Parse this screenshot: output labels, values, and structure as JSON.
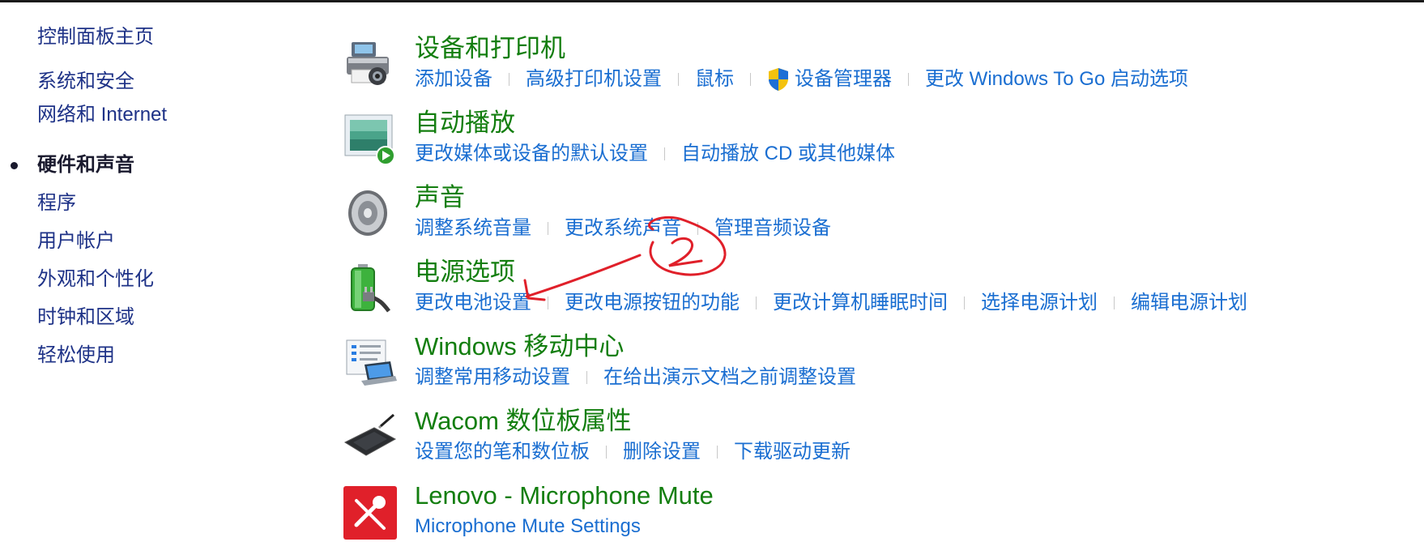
{
  "nav": {
    "items": [
      {
        "label": "控制面板主页",
        "active": false
      },
      {
        "label": "系统和安全",
        "active": false
      },
      {
        "label": "网络和 Internet",
        "active": false
      },
      {
        "label": "硬件和声音",
        "active": true
      },
      {
        "label": "程序",
        "active": false
      },
      {
        "label": "用户帐户",
        "active": false
      },
      {
        "label": "外观和个性化",
        "active": false
      },
      {
        "label": "时钟和区域",
        "active": false
      },
      {
        "label": "轻松使用",
        "active": false
      }
    ]
  },
  "categories": [
    {
      "title": "设备和打印机",
      "icon": "printer-icon",
      "links": [
        "添加设备",
        "高级打印机设置",
        "鼠标",
        "设备管理器",
        "更改 Windows To Go 启动选项"
      ]
    },
    {
      "title": "自动播放",
      "icon": "autoplay-icon",
      "links": [
        "更改媒体或设备的默认设置",
        "自动播放 CD 或其他媒体"
      ]
    },
    {
      "title": "声音",
      "icon": "speaker-icon",
      "links": [
        "调整系统音量",
        "更改系统声音",
        "管理音频设备"
      ]
    },
    {
      "title": "电源选项",
      "icon": "battery-icon",
      "links": [
        "更改电池设置",
        "更改电源按钮的功能",
        "更改计算机睡眠时间",
        "选择电源计划",
        "编辑电源计划"
      ]
    },
    {
      "title": "Windows 移动中心",
      "icon": "mobility-center-icon",
      "links": [
        "调整常用移动设置",
        "在给出演示文档之前调整设置"
      ]
    },
    {
      "title": "Wacom 数位板属性",
      "icon": "tablet-icon",
      "links": [
        "设置您的笔和数位板",
        "删除设置",
        "下载驱动更新"
      ]
    },
    {
      "title": "Lenovo - Microphone Mute",
      "icon": "microphone-mute-icon",
      "links": [
        "Microphone Mute Settings"
      ]
    }
  ],
  "colors": {
    "category_title": "#137e0f",
    "link": "#1a6ed1",
    "nav_link": "#1e3287",
    "annotation": "#e0202a"
  }
}
